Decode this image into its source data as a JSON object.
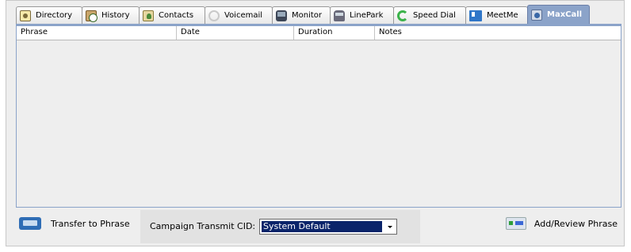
{
  "tabs": [
    {
      "id": "directory",
      "label": "Directory",
      "icon": "directory-icon"
    },
    {
      "id": "history",
      "label": "History",
      "icon": "history-icon"
    },
    {
      "id": "contacts",
      "label": "Contacts",
      "icon": "contacts-icon"
    },
    {
      "id": "voicemail",
      "label": "Voicemail",
      "icon": "voicemail-icon"
    },
    {
      "id": "monitor",
      "label": "Monitor",
      "icon": "monitor-icon"
    },
    {
      "id": "linepark",
      "label": "LinePark",
      "icon": "linepark-icon"
    },
    {
      "id": "speeddial",
      "label": "Speed Dial",
      "icon": "speed-dial-icon"
    },
    {
      "id": "meetme",
      "label": "MeetMe",
      "icon": "meetme-icon"
    },
    {
      "id": "maxcall",
      "label": "MaxCall",
      "icon": "maxcall-icon",
      "active": true
    }
  ],
  "table": {
    "columns": [
      "Phrase",
      "Date",
      "Duration",
      "Notes"
    ],
    "rows": []
  },
  "bottom": {
    "transfer_label": "Transfer to Phrase",
    "cid_label": "Campaign Transmit CID:",
    "cid_value": "System Default",
    "add_label": "Add/Review Phrase"
  },
  "colors": {
    "active_tab": "#8ba3c9",
    "selection": "#0a246a",
    "background": "#eeeeee"
  }
}
